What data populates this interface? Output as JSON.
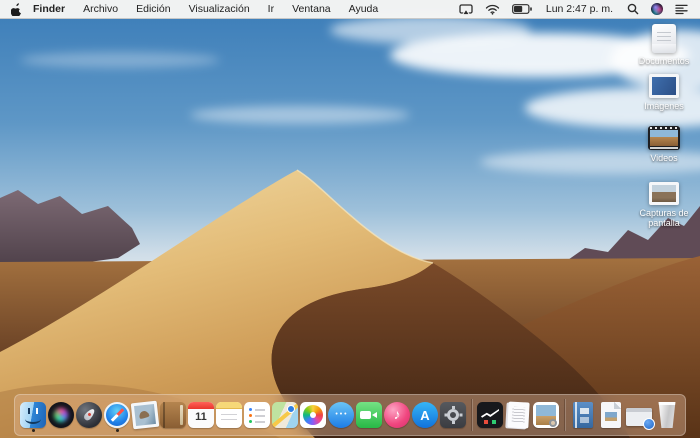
{
  "menubar": {
    "app_menu": "Finder",
    "menus": [
      "Archivo",
      "Edición",
      "Visualización",
      "Ir",
      "Ventana",
      "Ayuda"
    ],
    "status": {
      "clock": "Lun 2:47 p. m.",
      "icons": [
        "airplay-display-icon",
        "wifi-icon",
        "battery-icon",
        "spotlight-search-icon",
        "siri-icon",
        "notification-center-icon"
      ]
    }
  },
  "desktop": {
    "wallpaper": "mojave-dunes",
    "icons": [
      {
        "name": "documentos",
        "label": "Documentos"
      },
      {
        "name": "imagenes",
        "label": "Imágenes"
      },
      {
        "name": "videos",
        "label": "Videos"
      },
      {
        "name": "capturas-de-pantalla",
        "label": "Capturas de pantalla"
      }
    ]
  },
  "dock": {
    "items": [
      {
        "name": "finder",
        "running": true
      },
      {
        "name": "siri"
      },
      {
        "name": "launchpad"
      },
      {
        "name": "safari",
        "running": true
      },
      {
        "name": "mail"
      },
      {
        "name": "contacts"
      },
      {
        "name": "calendar",
        "day": "11"
      },
      {
        "name": "notes"
      },
      {
        "name": "reminders"
      },
      {
        "name": "maps"
      },
      {
        "name": "photos"
      },
      {
        "name": "messages"
      },
      {
        "name": "facetime"
      },
      {
        "name": "itunes"
      },
      {
        "name": "app-store"
      },
      {
        "name": "system-preferences"
      },
      {
        "name": "separator"
      },
      {
        "name": "stocks"
      },
      {
        "name": "textedit"
      },
      {
        "name": "preview"
      },
      {
        "name": "separator"
      },
      {
        "name": "doc-book"
      },
      {
        "name": "doc-file"
      },
      {
        "name": "minimized-window"
      },
      {
        "name": "trash"
      }
    ]
  },
  "colors": {
    "menubar_bg": "#f8f7f5",
    "dock_tint": "#d8baa4",
    "sky_top": "#3a7cb8",
    "sand_light": "#e9c98c",
    "sand_dark": "#5a3620",
    "label_text": "#ffffff"
  }
}
